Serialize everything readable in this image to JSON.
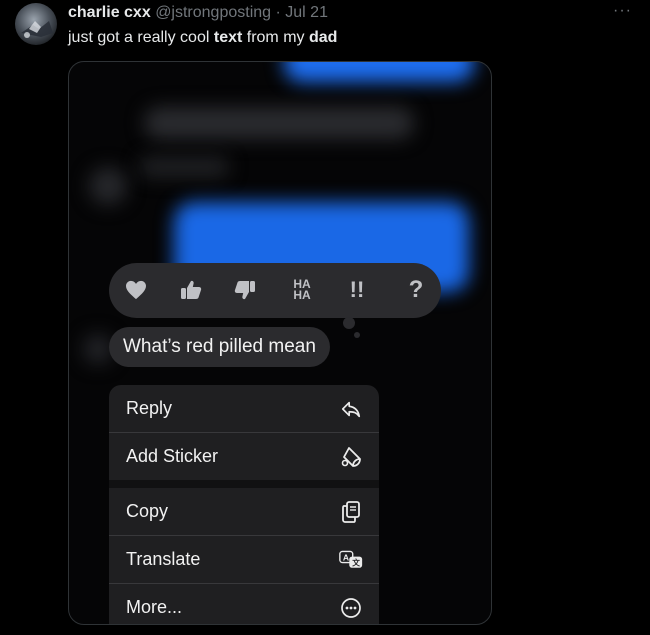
{
  "author": {
    "name": "charlie cxx",
    "handle": "@jstrongposting",
    "separator": "·",
    "date": "Jul 21"
  },
  "more_label": "···",
  "tweet": {
    "text_1": "just got a really cool ",
    "bold_1": "text",
    "text_2": " from my ",
    "bold_2": "dad"
  },
  "message": {
    "text": "What’s red pilled mean"
  },
  "tapbacks": [
    {
      "icon": "heart-icon"
    },
    {
      "icon": "thumbs-up-icon"
    },
    {
      "icon": "thumbs-down-icon"
    },
    {
      "icon": "haha-icon",
      "label_top": "HA",
      "label_bottom": "HA"
    },
    {
      "icon": "exclamation-icon",
      "label": "!!"
    },
    {
      "icon": "question-icon",
      "label": "?"
    }
  ],
  "context_menu": {
    "items": [
      {
        "label": "Reply",
        "icon": "reply-icon"
      },
      {
        "label": "Add Sticker",
        "icon": "sticker-icon"
      },
      {
        "label": "Copy",
        "icon": "copy-icon"
      },
      {
        "label": "Translate",
        "icon": "translate-icon"
      },
      {
        "label": "More...",
        "icon": "more-circle-icon"
      }
    ]
  }
}
